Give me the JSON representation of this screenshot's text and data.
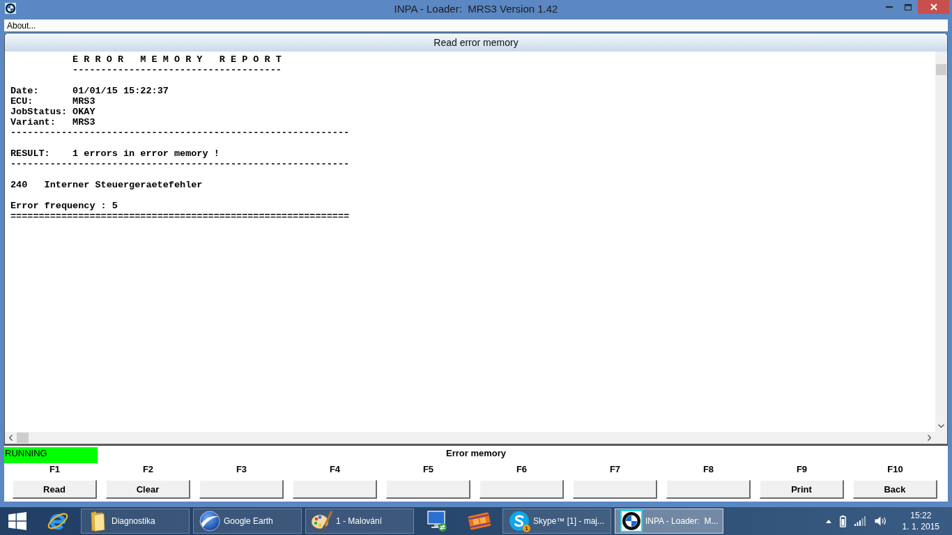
{
  "window": {
    "title": "INPA - Loader:  MRS3 Version 1.42"
  },
  "menu": [
    {
      "label": "About..."
    }
  ],
  "panel": {
    "title": "Read error memory",
    "report": [
      {
        "kind": "heading",
        "text": "E R R O R   M E M O R Y   R E P O R T",
        "rule": "-------------------------------------"
      },
      {
        "kind": "fields",
        "rows": [
          {
            "label": "Date:",
            "value": "01/01/15 15:22:37"
          },
          {
            "label": "ECU:",
            "value": "MRS3"
          },
          {
            "label": "JobStatus:",
            "value": "OKAY"
          },
          {
            "label": "Variant:",
            "value": "MRS3"
          }
        ],
        "rule": "------------------------------------------------------------"
      },
      {
        "kind": "result",
        "label": "RESULT:",
        "text": "1 errors in error memory !",
        "rule": "------------------------------------------------------------"
      },
      {
        "kind": "error",
        "code": "240",
        "text": "Interner Steuergeraetefehler"
      },
      {
        "kind": "line",
        "text": "Error frequency : 5",
        "rule": "============================================================"
      }
    ]
  },
  "status": {
    "state": "RUNNING",
    "caption": "Error memory"
  },
  "function_keys": [
    {
      "key": "F1",
      "label": "Read"
    },
    {
      "key": "F2",
      "label": "Clear"
    },
    {
      "key": "F3"
    },
    {
      "key": "F4"
    },
    {
      "key": "F5"
    },
    {
      "key": "F6"
    },
    {
      "key": "F7"
    },
    {
      "key": "F8"
    },
    {
      "key": "F9",
      "label": "Print"
    },
    {
      "key": "F10",
      "label": "Back"
    }
  ],
  "taskbar": {
    "items": [
      {
        "kind": "start",
        "selected": false
      },
      {
        "kind": "pinned",
        "selected": false
      },
      {
        "kind": "window",
        "label": "Diagnostika",
        "selected": false
      },
      {
        "kind": "window",
        "label": "Google Earth",
        "selected": false
      },
      {
        "kind": "window",
        "label": "1 - Malování",
        "selected": false
      },
      {
        "kind": "pinned",
        "selected": false
      },
      {
        "kind": "pinned",
        "selected": false
      },
      {
        "kind": "window",
        "label": "Skype™ [1] - maj...",
        "badge": "1",
        "selected": false
      },
      {
        "kind": "window",
        "label": "INPA - Loader:  M...",
        "selected": true
      }
    ],
    "clock": {
      "time": "15:22",
      "date": "1. 1. 2015"
    }
  }
}
